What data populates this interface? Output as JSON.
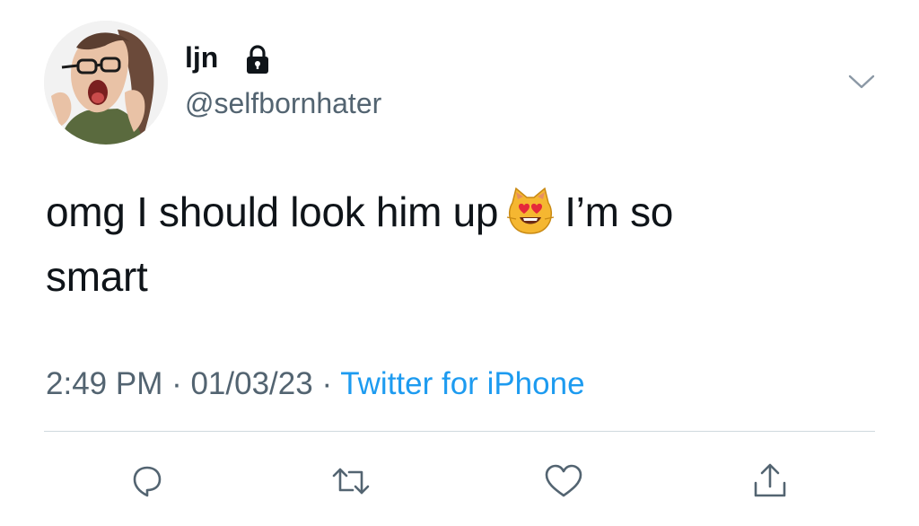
{
  "user": {
    "display_name": "ljn",
    "handle": "@selfbornhater",
    "protected_icon": "lock-icon",
    "avatar_icon": "anime-avatar"
  },
  "tweet": {
    "text_line1_before_emoji": "omg I should look him up",
    "emoji": "smiling-cat-heart-eyes-emoji",
    "text_line1_after_emoji": "I’m so",
    "text_line2": "smart"
  },
  "meta": {
    "time": "2:49 PM",
    "separator": " · ",
    "date": "01/03/23",
    "source": "Twitter for iPhone"
  },
  "actions": {
    "reply_icon": "reply-icon",
    "retweet_icon": "retweet-icon",
    "like_icon": "heart-icon",
    "share_icon": "share-icon"
  },
  "menu": {
    "icon": "chevron-down-icon"
  },
  "colors": {
    "text": "#0f1419",
    "secondary": "#536471",
    "accent": "#1d9bf0",
    "divider": "#cfd9de"
  }
}
